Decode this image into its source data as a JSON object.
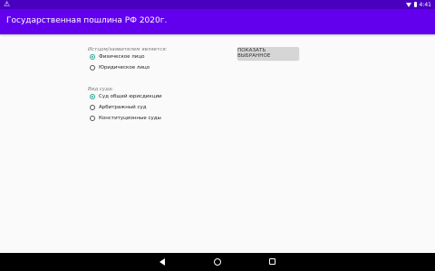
{
  "status_bar": {
    "warning_icon": "warning-icon",
    "time": "4:41"
  },
  "app_bar": {
    "title": "Государственная пошлина РФ 2020г."
  },
  "applicant_group": {
    "label": "Истцом/заявителем является:",
    "options": [
      {
        "label": "Физическое лицо",
        "checked": true
      },
      {
        "label": "Юридическое лицо",
        "checked": false
      }
    ]
  },
  "court_group": {
    "label": "Вид суда:",
    "options": [
      {
        "label": "Суд общей юрисдикции",
        "checked": true
      },
      {
        "label": "Арбитражный суд",
        "checked": false
      },
      {
        "label": "Конституционные суды",
        "checked": false
      }
    ]
  },
  "show_button": {
    "label": "ПОКАЗАТЬ ВЫБРАННОЕ"
  },
  "colors": {
    "status_bar": "#4a00c0",
    "app_bar": "#6200ee",
    "radio_accent": "#26a69a"
  }
}
